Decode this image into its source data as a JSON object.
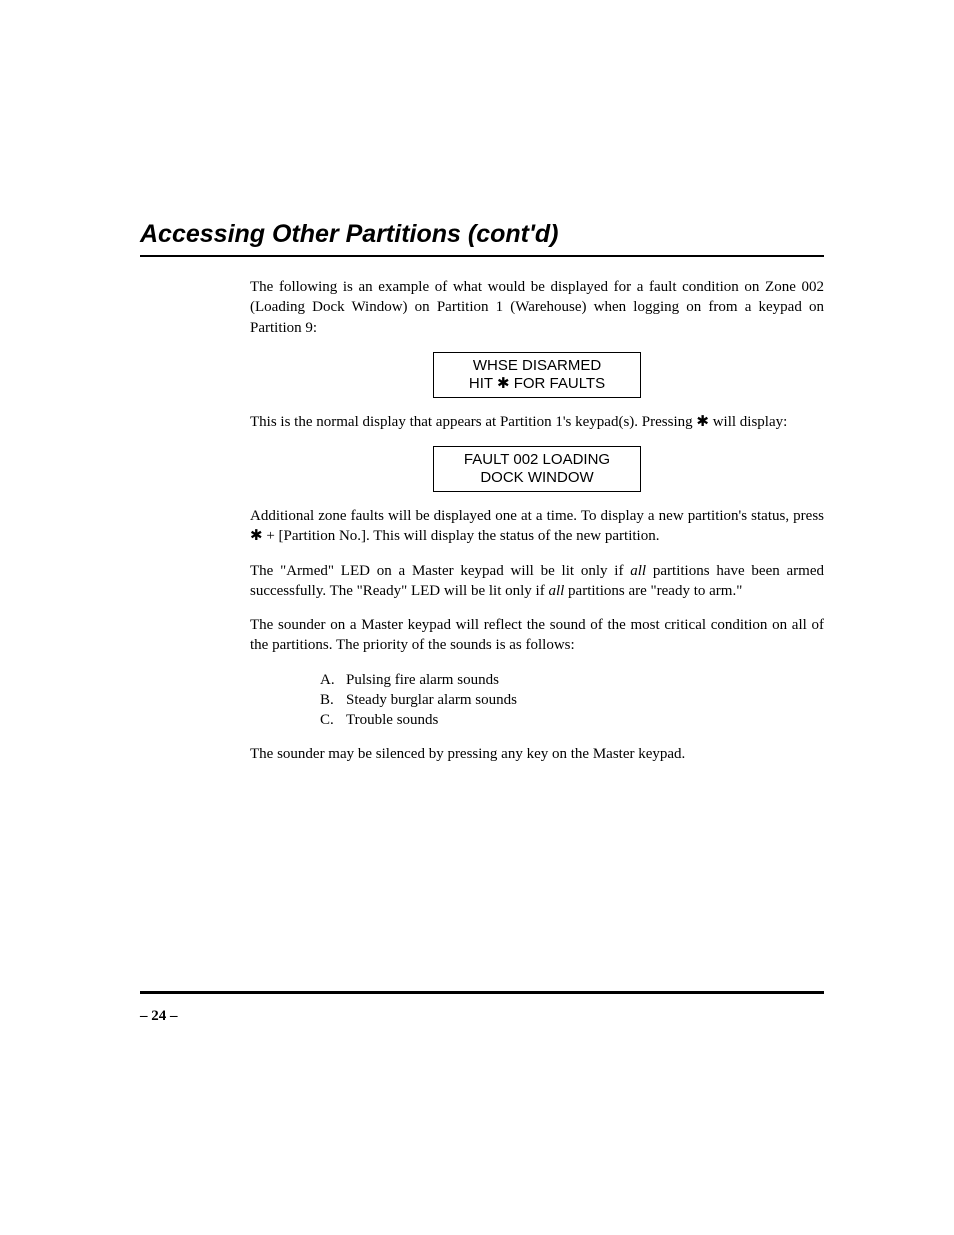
{
  "title": "Accessing Other Partitions (cont'd)",
  "p1": "The following is an example of what would be displayed for a fault condition on Zone 002 (Loading Dock Window) on Partition 1 (Warehouse) when logging on from a keypad on Partition 9:",
  "lcd1_line1": "WHSE DISARMED",
  "lcd1_line2a": "HIT ",
  "lcd1_line2b": " FOR FAULTS",
  "p2a": "This is the normal display that appears at Partition 1's keypad(s). Pressing ",
  "p2b": " will display:",
  "lcd2_line1": "FAULT 002 LOADING",
  "lcd2_line2": "DOCK WINDOW",
  "p3a": "Additional zone faults will be displayed one at a time.  To display a new partition's status, press ",
  "p3b": " + [Partition No.].  This will display the status of the new partition.",
  "p4a": "The \"Armed\" LED on a Master keypad will be lit only if ",
  "p4_em1": "all",
  "p4b": " partitions have been armed successfully.  The \"Ready\" LED will be lit only if ",
  "p4_em2": "all",
  "p4c": " partitions are \"ready to arm.\"",
  "p5": "The sounder on a Master keypad will reflect the sound of the most critical condition on all of the partitions.  The priority of the sounds is as follows:",
  "list": {
    "a_lbl": "A.",
    "a": "Pulsing fire alarm sounds",
    "b_lbl": "B.",
    "b": "Steady burglar alarm sounds",
    "c_lbl": "C.",
    "c": "Trouble sounds"
  },
  "p6": "The sounder may be silenced by pressing any key on the Master keypad.",
  "star": "✱",
  "page_number": "– 24 –"
}
